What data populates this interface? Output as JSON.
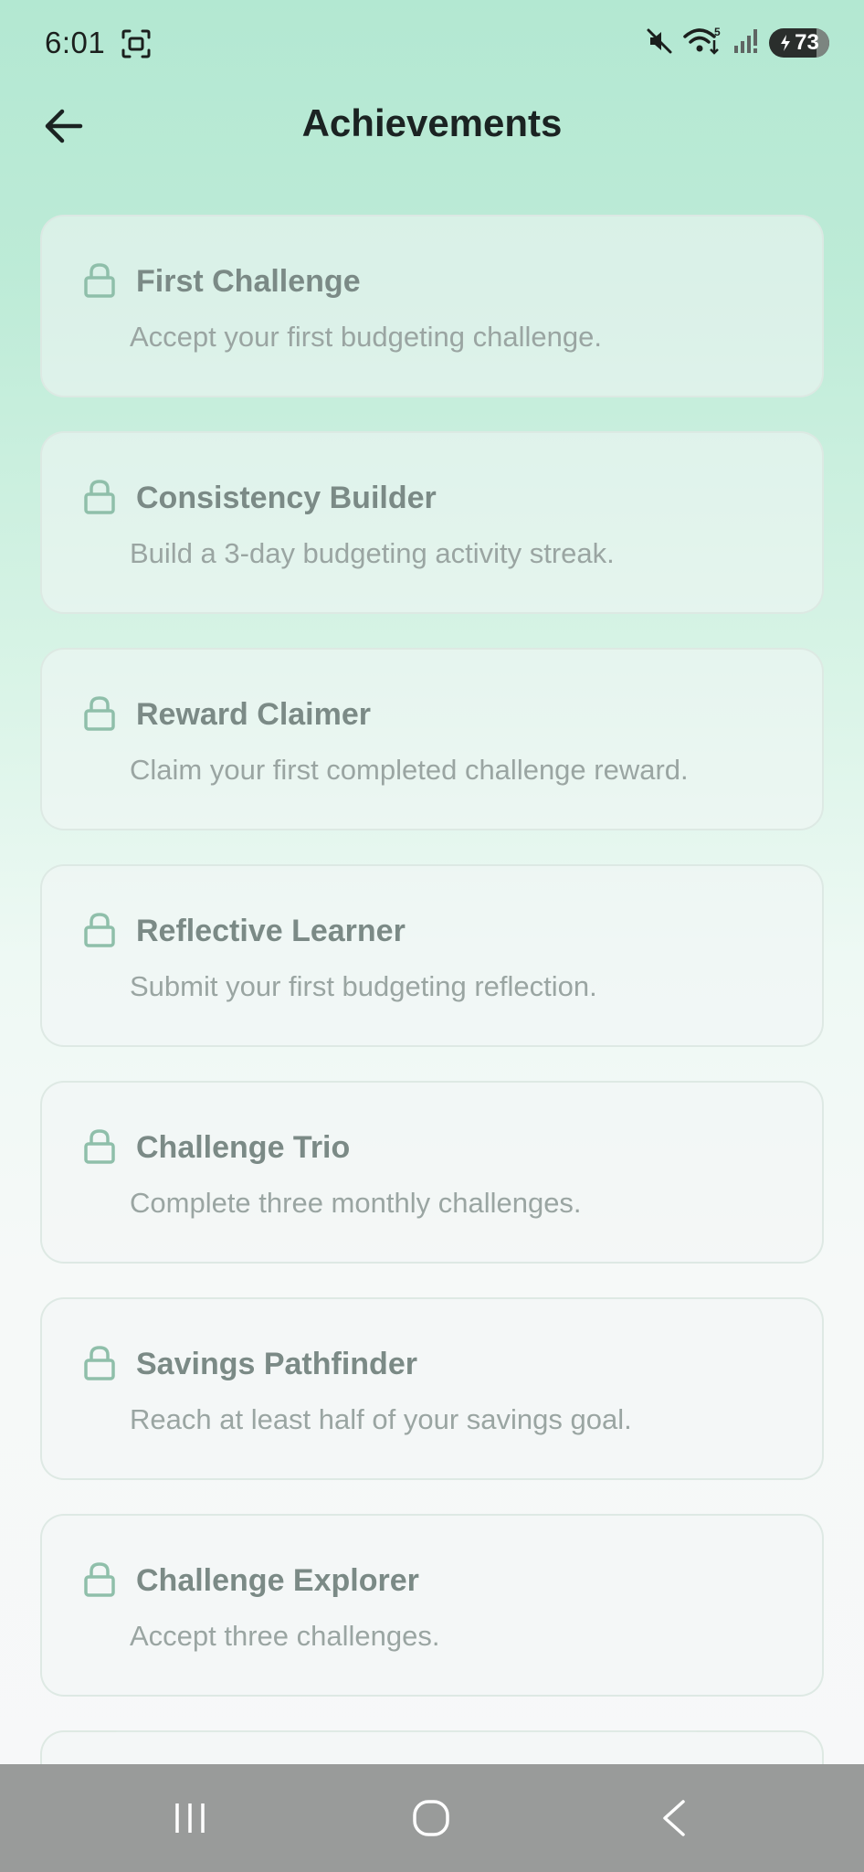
{
  "status_bar": {
    "time": "6:01",
    "battery_level": "73",
    "wifi_badge": "5"
  },
  "header": {
    "title": "Achievements"
  },
  "achievements": [
    {
      "title": "First Challenge",
      "description": "Accept your first budgeting challenge."
    },
    {
      "title": "Consistency Builder",
      "description": "Build a 3-day budgeting activity streak."
    },
    {
      "title": "Reward Claimer",
      "description": "Claim your first completed challenge reward."
    },
    {
      "title": "Reflective Learner",
      "description": "Submit your first budgeting reflection."
    },
    {
      "title": "Challenge Trio",
      "description": "Complete three monthly challenges."
    },
    {
      "title": "Savings Pathfinder",
      "description": "Reach at least half of your savings goal."
    },
    {
      "title": "Challenge Explorer",
      "description": "Accept three challenges."
    }
  ],
  "colors": {
    "lock_icon": "#8fbfaa",
    "title_text": "#7b8a86",
    "description_text": "#9aa5a2",
    "gradient_top": "#b3e8d2",
    "nav_bar": "#999b9a"
  },
  "icons": {
    "back": "arrow-left-icon",
    "lock": "lock-icon",
    "nav_recents": "recents-icon",
    "nav_home": "home-icon",
    "nav_back": "chevron-left-icon"
  }
}
